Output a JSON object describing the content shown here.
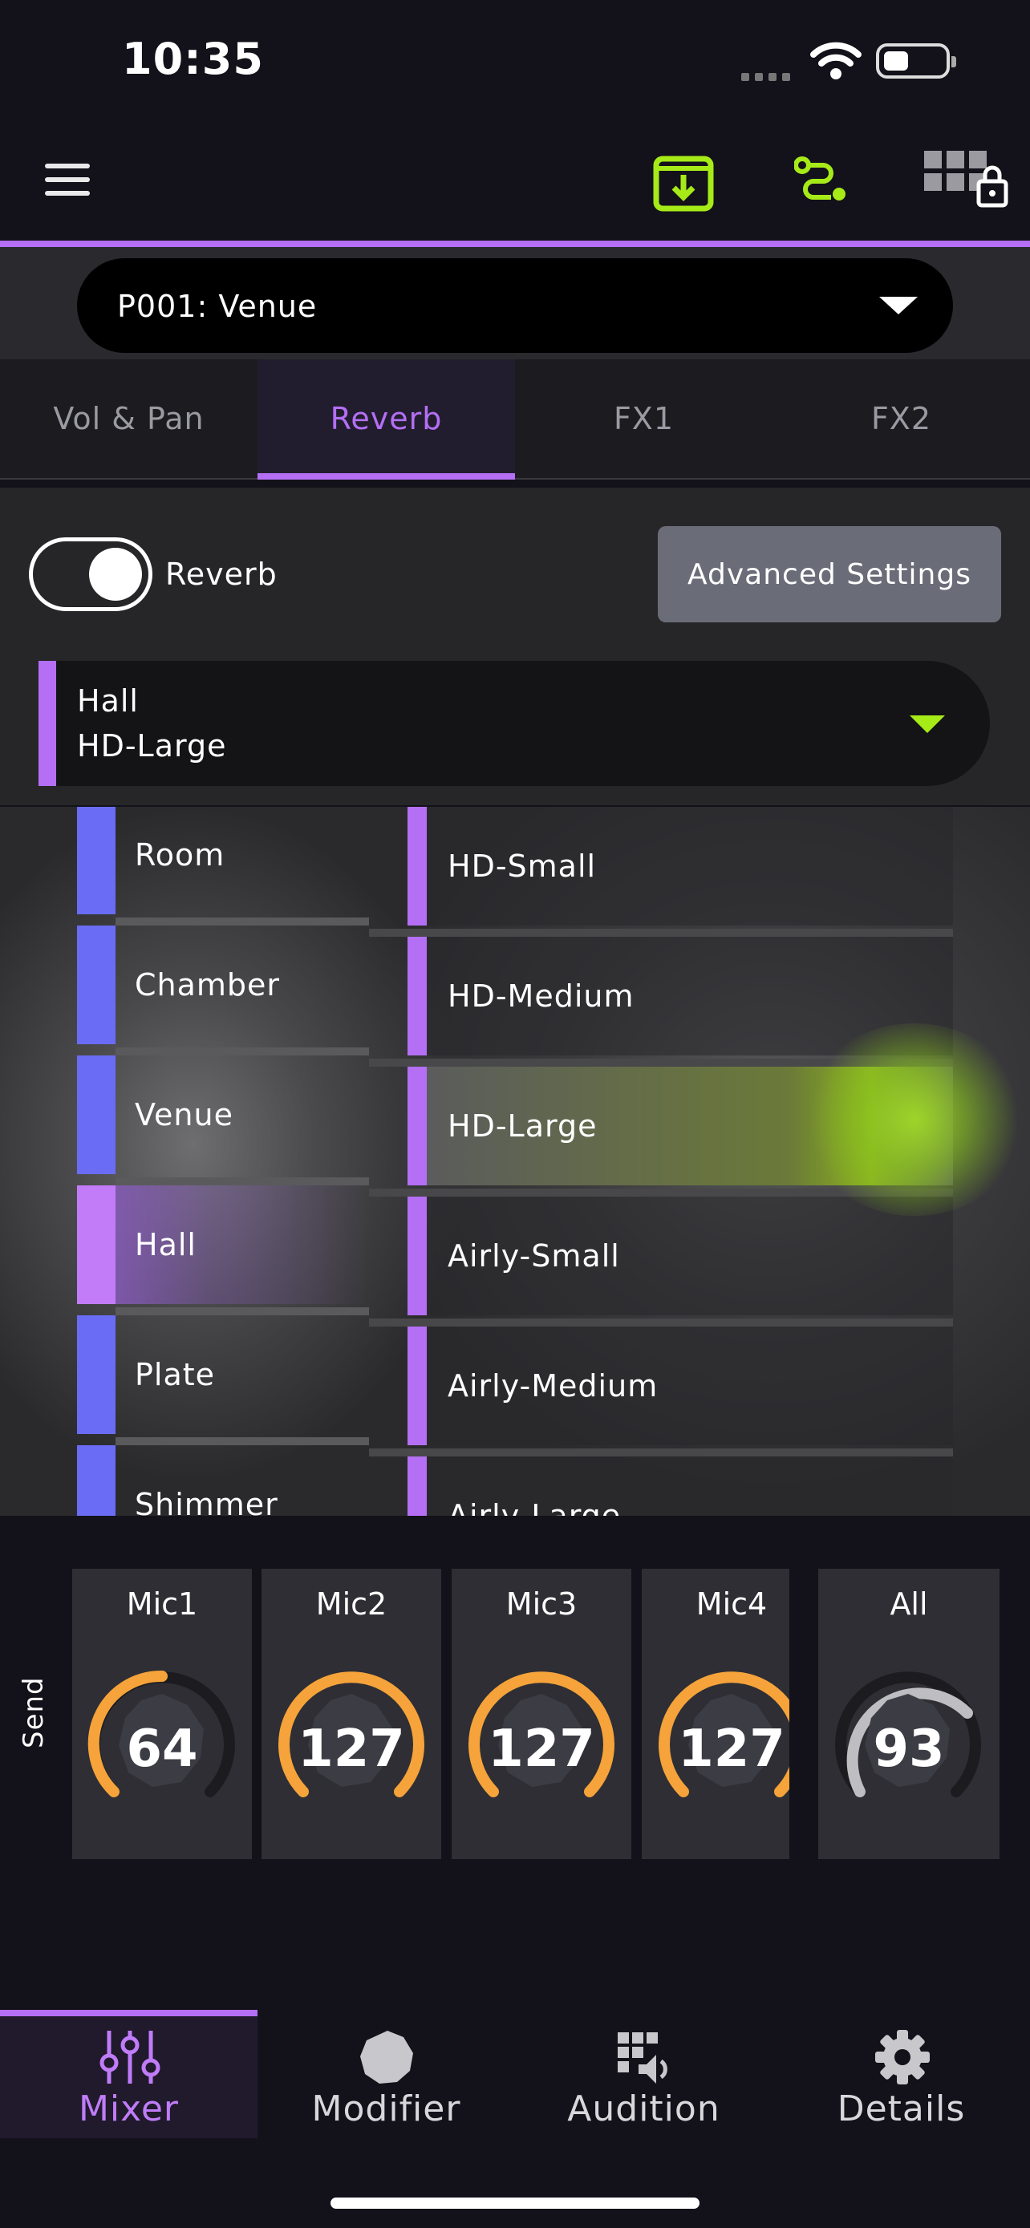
{
  "status_bar": {
    "time": "10:35"
  },
  "header": {
    "menu_icon": "hamburger-icon",
    "save_icon": "save-download-icon",
    "route_icon": "route-icon",
    "grid_lock_icon": "grid-lock-icon",
    "accent_color": "#b46ff5",
    "highlight_color": "#a6ea18"
  },
  "program": {
    "value": "P001: Venue"
  },
  "tabs": [
    {
      "label": "Vol & Pan"
    },
    {
      "label": "Reverb"
    },
    {
      "label": "FX1"
    },
    {
      "label": "FX2"
    }
  ],
  "reverb": {
    "toggle_label": "Reverb",
    "enabled": true,
    "advanced_label": "Advanced Settings",
    "selected_type": "Hall",
    "selected_variant": "HD-Large"
  },
  "categories": [
    {
      "label": "Room"
    },
    {
      "label": "Chamber"
    },
    {
      "label": "Venue"
    },
    {
      "label": "Hall"
    },
    {
      "label": "Plate"
    },
    {
      "label": "Shimmer"
    }
  ],
  "variants": [
    {
      "label": "HD-Small"
    },
    {
      "label": "HD-Medium"
    },
    {
      "label": "HD-Large"
    },
    {
      "label": "Airly-Small"
    },
    {
      "label": "Airly-Medium"
    },
    {
      "label": "Airly-Large"
    }
  ],
  "send": {
    "label": "Send",
    "knobs": [
      {
        "name": "Mic1",
        "value": "64"
      },
      {
        "name": "Mic2",
        "value": "127"
      },
      {
        "name": "Mic3",
        "value": "127"
      },
      {
        "name": "Mic4",
        "value": "127"
      },
      {
        "name": "All",
        "value": "93"
      }
    ]
  },
  "nav": [
    {
      "label": "Mixer"
    },
    {
      "label": "Modifier"
    },
    {
      "label": "Audition"
    },
    {
      "label": "Details"
    }
  ]
}
